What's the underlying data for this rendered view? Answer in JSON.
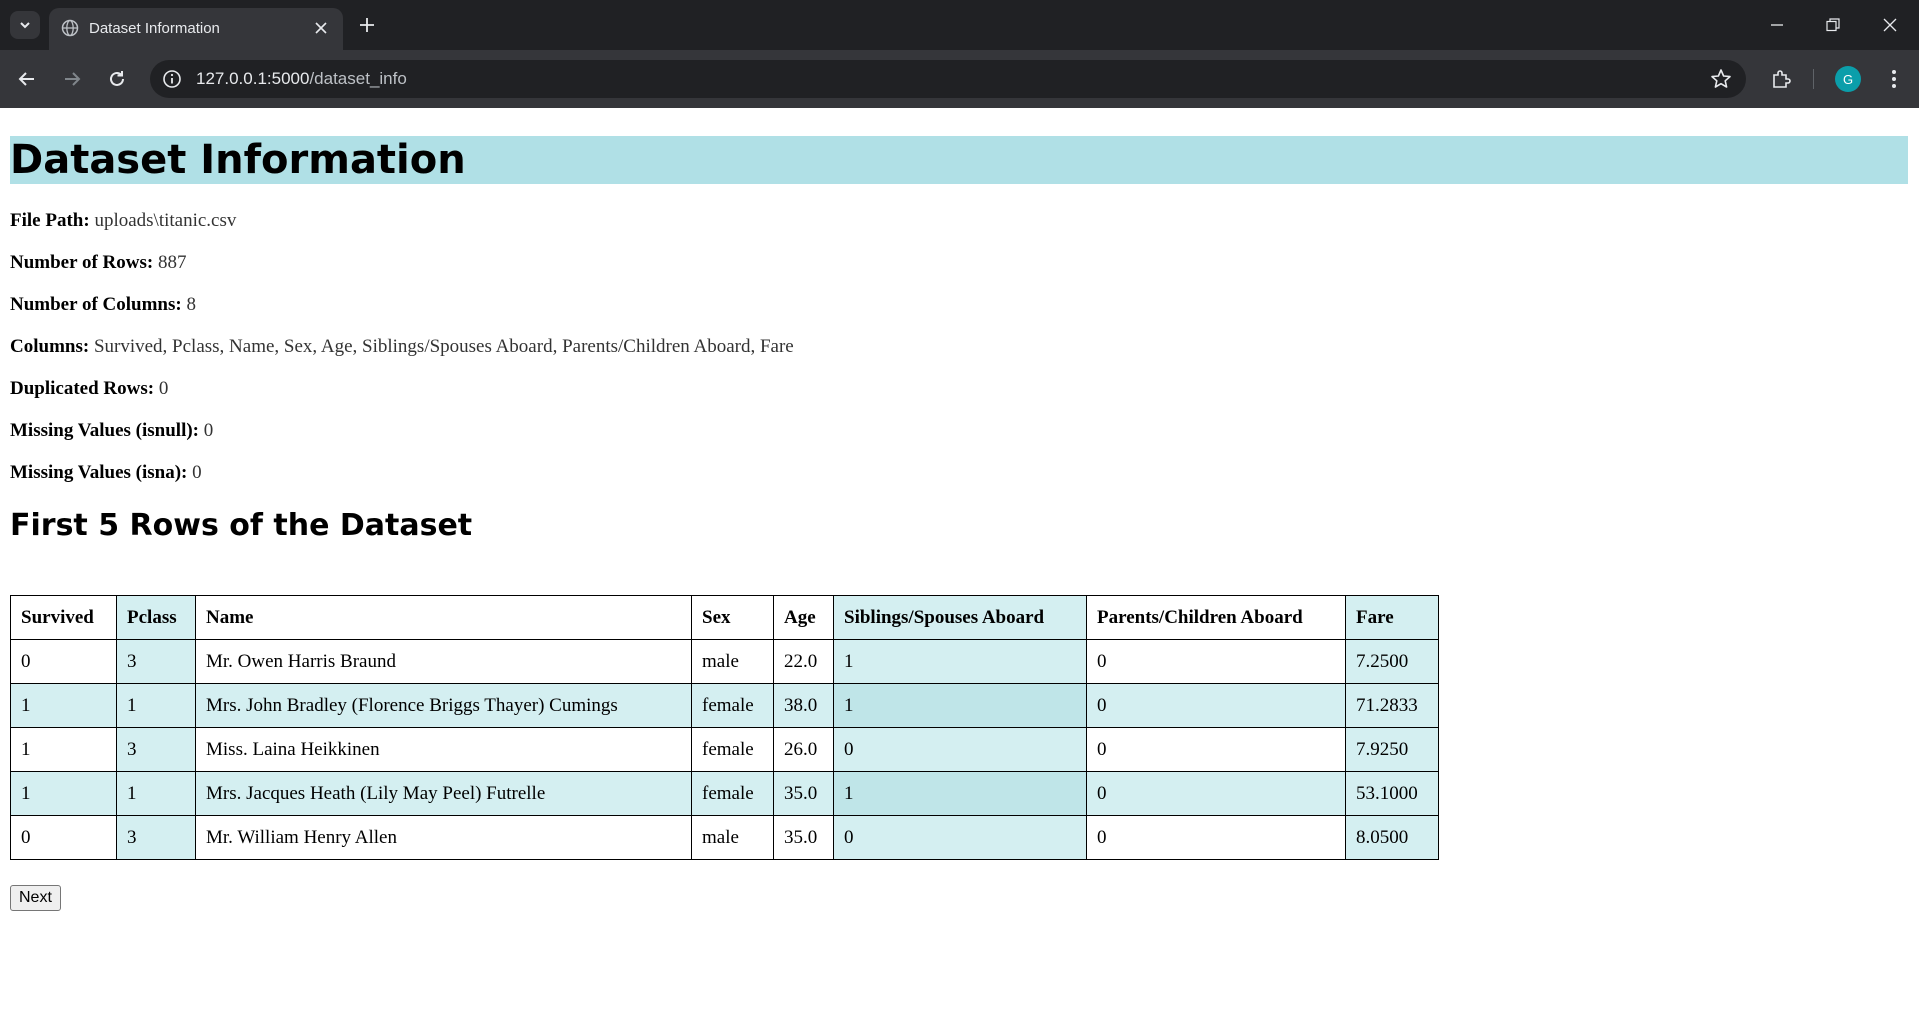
{
  "browser": {
    "tab_title": "Dataset Information",
    "url_host": "127.0.0.1:5000",
    "url_path": "/dataset_info",
    "profile_initial": "G"
  },
  "page": {
    "title": "Dataset Information",
    "info": [
      {
        "label": "File Path:",
        "value": "uploads\\titanic.csv"
      },
      {
        "label": "Number of Rows:",
        "value": "887"
      },
      {
        "label": "Number of Columns:",
        "value": "8"
      },
      {
        "label": "Columns:",
        "value": "Survived, Pclass, Name, Sex, Age, Siblings/Spouses Aboard, Parents/Children Aboard, Fare"
      },
      {
        "label": "Duplicated Rows:",
        "value": "0"
      },
      {
        "label": "Missing Values (isnull):",
        "value": "0"
      },
      {
        "label": "Missing Values (isna):",
        "value": "0"
      }
    ],
    "subtitle": "First 5 Rows of the Dataset",
    "table": {
      "headers": [
        "Survived",
        "Pclass",
        "Name",
        "Sex",
        "Age",
        "Siblings/Spouses Aboard",
        "Parents/Children Aboard",
        "Fare"
      ],
      "rows": [
        [
          "0",
          "3",
          "Mr. Owen Harris Braund",
          "male",
          "22.0",
          "1",
          "0",
          "7.2500"
        ],
        [
          "1",
          "1",
          "Mrs. John Bradley (Florence Briggs Thayer) Cumings",
          "female",
          "38.0",
          "1",
          "0",
          "71.2833"
        ],
        [
          "1",
          "3",
          "Miss. Laina Heikkinen",
          "female",
          "26.0",
          "0",
          "0",
          "7.9250"
        ],
        [
          "1",
          "1",
          "Mrs. Jacques Heath (Lily May Peel) Futrelle",
          "female",
          "35.0",
          "1",
          "0",
          "53.1000"
        ],
        [
          "0",
          "3",
          "Mr. William Henry Allen",
          "male",
          "35.0",
          "0",
          "0",
          "8.0500"
        ]
      ]
    },
    "next_label": "Next"
  },
  "colors": {
    "title_bg": "#b0e0e6",
    "stripe": "#d4eff1",
    "chrome_dark": "#202124",
    "chrome_tab": "#35363a"
  },
  "icons": [
    "tab-search-icon",
    "globe-icon",
    "close-icon",
    "plus-icon",
    "minimize-icon",
    "restore-icon",
    "back-icon",
    "forward-icon",
    "reload-icon",
    "info-icon",
    "star-icon",
    "extensions-icon",
    "more-icon"
  ]
}
